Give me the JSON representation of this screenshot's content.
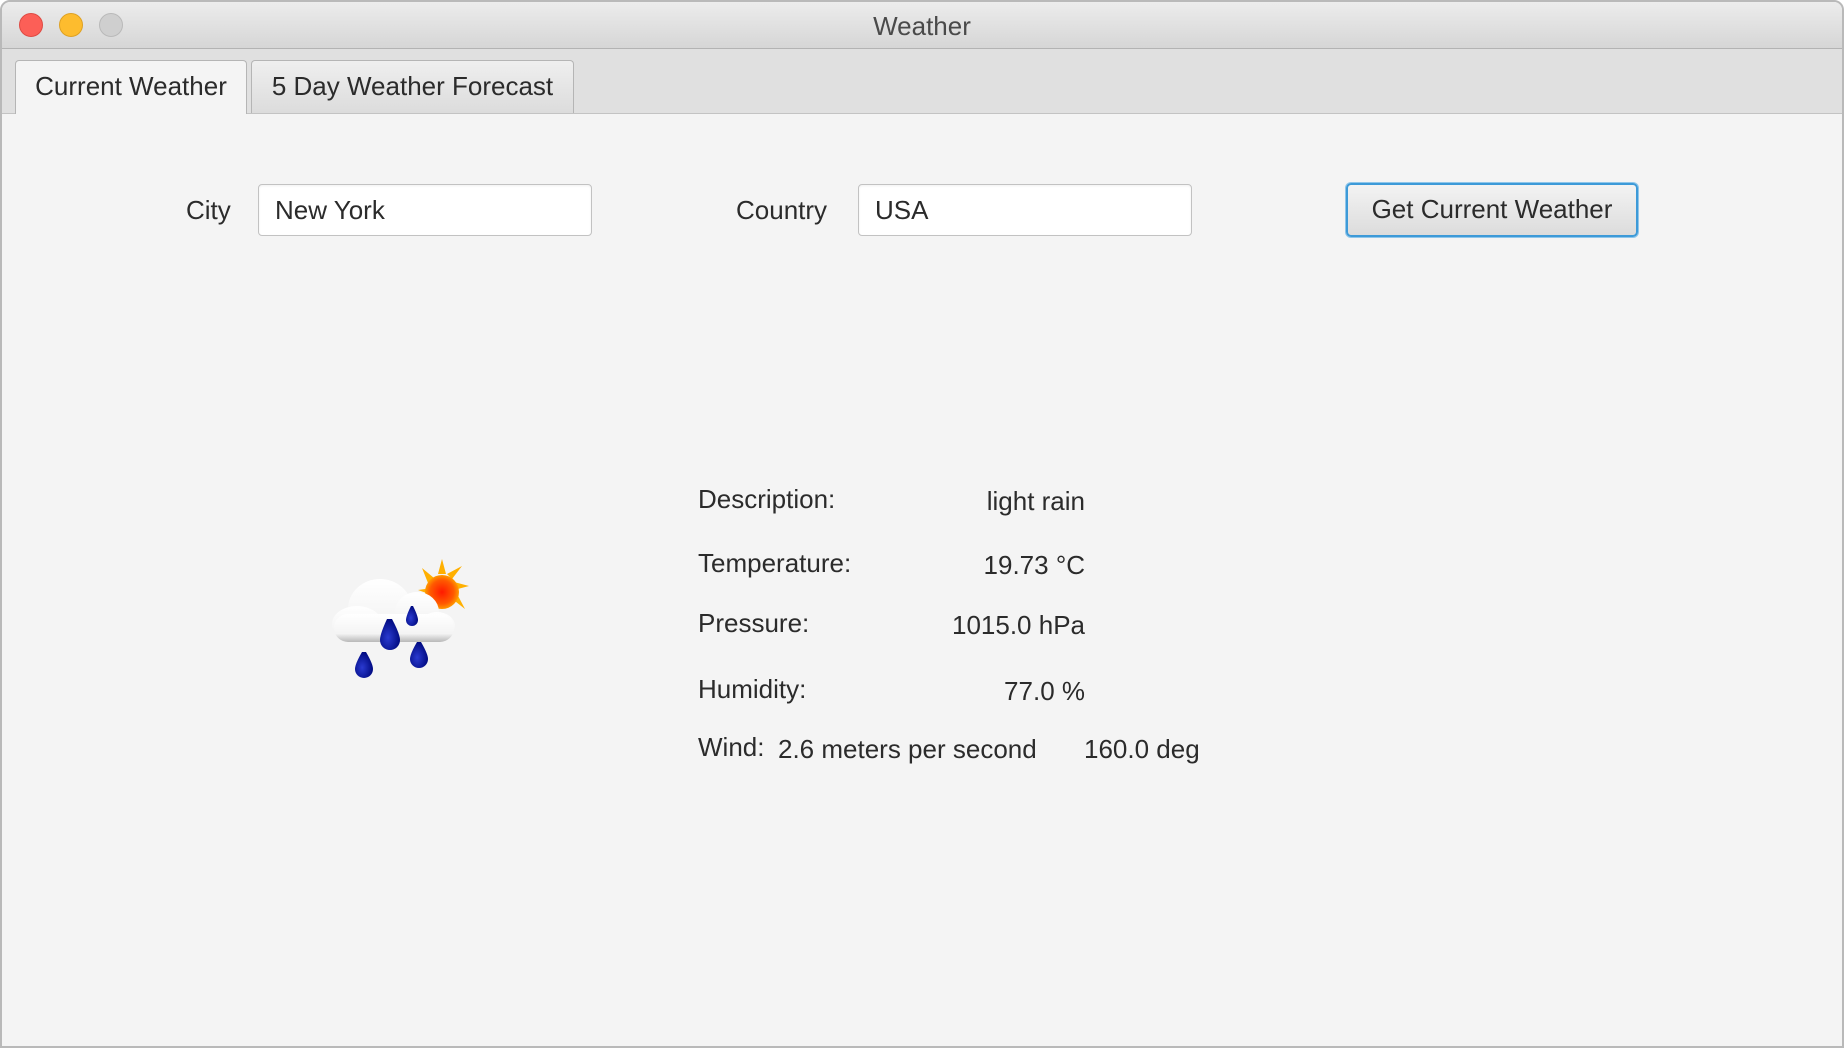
{
  "window": {
    "title": "Weather"
  },
  "tabs": [
    {
      "label": "Current Weather",
      "active": true
    },
    {
      "label": "5 Day Weather Forecast",
      "active": false
    }
  ],
  "form": {
    "city_label": "City",
    "city_value": "New York",
    "country_label": "Country",
    "country_value": "USA",
    "submit_label": "Get Current Weather"
  },
  "weather": {
    "icon": "light-rain-sun-icon",
    "description_label": "Description:",
    "description_value": "light rain",
    "temperature_label": "Temperature:",
    "temperature_value": "19.73 °C",
    "pressure_label": "Pressure:",
    "pressure_value": "1015.0 hPa",
    "humidity_label": "Humidity:",
    "humidity_value": "77.0 %",
    "wind_label": "Wind:",
    "wind_speed": "2.6 meters per second",
    "wind_direction": "160.0 deg"
  },
  "colors": {
    "accent": "#3d9ad8",
    "close": "#fc5f57",
    "minimize": "#fdbc2e",
    "zoom": "#cfcfcf",
    "rain_drop": "#0a1aa0",
    "sun": "#ff9a00"
  }
}
